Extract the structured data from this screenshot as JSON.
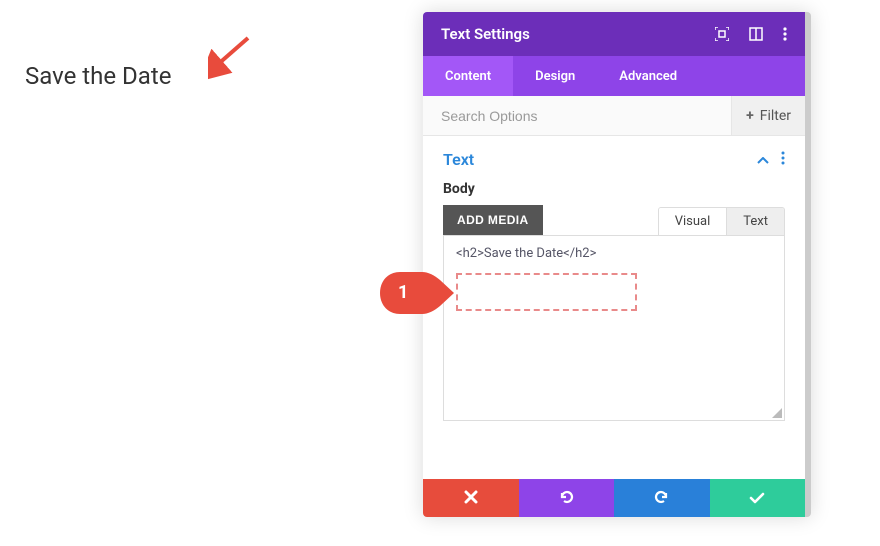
{
  "preview": {
    "heading": "Save the Date"
  },
  "panel": {
    "title": "Text Settings",
    "tabs": {
      "content": "Content",
      "design": "Design",
      "advanced": "Advanced"
    }
  },
  "search": {
    "placeholder": "Search Options",
    "filter": "Filter"
  },
  "section": {
    "title": "Text",
    "body_label": "Body"
  },
  "editor": {
    "add_media": "ADD MEDIA",
    "tabs": {
      "visual": "Visual",
      "text": "Text"
    },
    "content": "<h2>Save the Date</h2>"
  },
  "callout": {
    "number": "1"
  },
  "colors": {
    "headerPurple": "#6c2eb9",
    "tabPurple": "#8e44e8",
    "red": "#e74c3c",
    "blue": "#2980d9",
    "green": "#2ecc9b"
  }
}
